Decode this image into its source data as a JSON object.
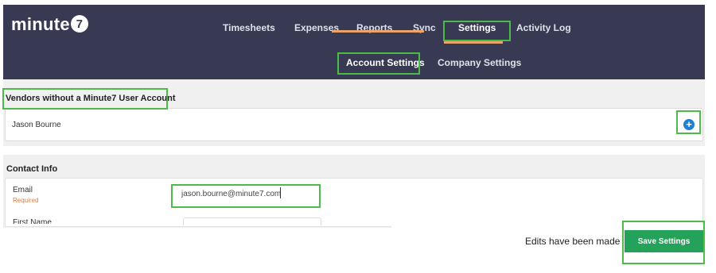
{
  "brand": {
    "logo_text": "minute",
    "logo_mark": "7"
  },
  "nav": {
    "items": [
      "Timesheets",
      "Expenses",
      "Reports",
      "Sync",
      "Settings",
      "Activity Log"
    ],
    "active": "Settings"
  },
  "subnav": {
    "items": [
      "Account Settings",
      "Company Settings"
    ],
    "active": "Account Settings"
  },
  "vendors": {
    "title": "Vendors without a Minute7 User Account",
    "items": [
      "Jason Bourne"
    ],
    "add_icon": "plus-circle-icon"
  },
  "contact": {
    "title": "Contact Info",
    "email_label": "Email",
    "email_required": "Required",
    "email_value": "jason.bourne@minute7.com",
    "first_name_label": "First Name"
  },
  "footer": {
    "status_text": "Edits have been made",
    "save_label": "Save Settings"
  },
  "colors": {
    "nav_bg": "#373a52",
    "accent_underline": "#e9a46b",
    "save_green": "#25a25a",
    "add_blue": "#1f7fd4",
    "required_orange": "#e07a3d",
    "highlight_green": "#4cbb47"
  }
}
